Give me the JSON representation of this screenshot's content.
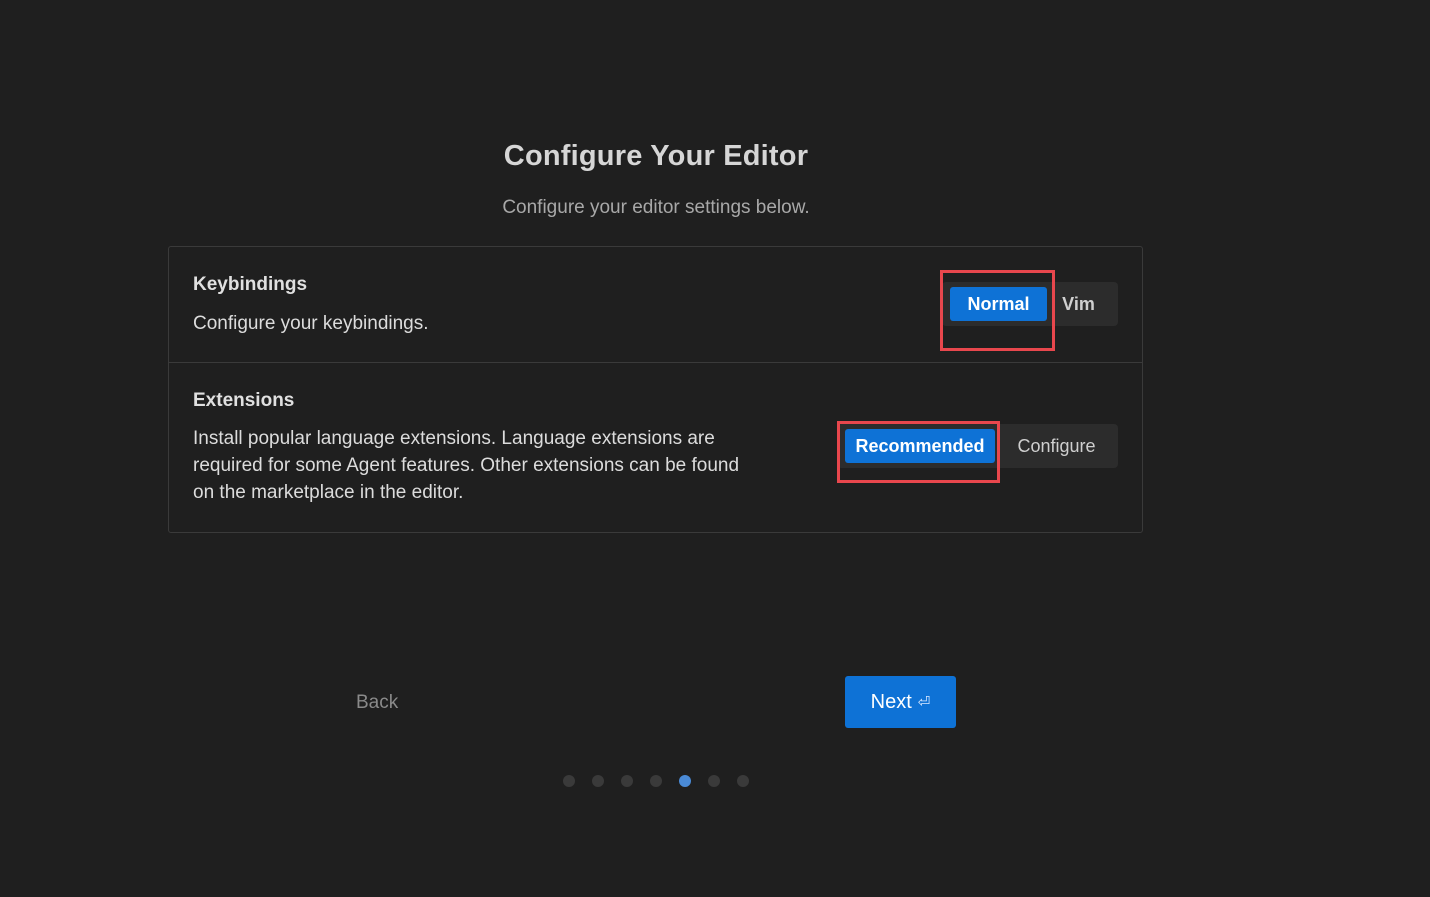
{
  "header": {
    "title": "Configure Your Editor",
    "subtitle": "Configure your editor settings below."
  },
  "settings": {
    "keybindings": {
      "title": "Keybindings",
      "description": "Configure your keybindings.",
      "options": [
        "Normal",
        "Vim"
      ],
      "selected": "Normal"
    },
    "extensions": {
      "title": "Extensions",
      "description": "Install popular language extensions. Language extensions are required for some Agent features. Other extensions can be found on the marketplace in the editor.",
      "options": [
        "Recommended",
        "Configure"
      ],
      "selected": "Recommended"
    }
  },
  "footer": {
    "back_label": "Back",
    "next_label": "Next",
    "next_icon": "⏎"
  },
  "pagination": {
    "total": 7,
    "current": 5
  },
  "colors": {
    "background": "#1f1f1f",
    "accent": "#0e72d6",
    "highlight_border": "#e8474d",
    "active_dot": "#4a8ad6"
  },
  "icons": {
    "enter": "return-enter-icon"
  }
}
